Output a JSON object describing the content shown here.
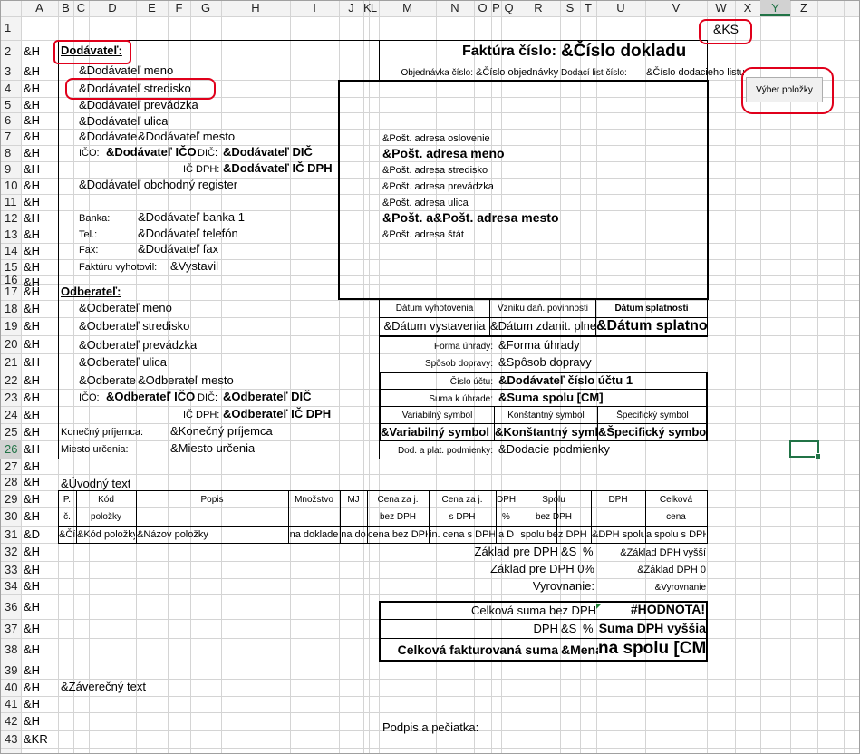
{
  "columns": [
    "A",
    "B",
    "C",
    "D",
    "E",
    "F",
    "G",
    "H",
    "I",
    "J",
    "K",
    "L",
    "M",
    "N",
    "O",
    "P",
    "Q",
    "R",
    "S",
    "T",
    "U",
    "V",
    "W",
    "X",
    "Y",
    "Z"
  ],
  "rows": [
    "1",
    "2",
    "3",
    "4",
    "5",
    "6",
    "7",
    "8",
    "9",
    "10",
    "11",
    "12",
    "13",
    "14",
    "15",
    "16",
    "17",
    "18",
    "19",
    "20",
    "21",
    "22",
    "23",
    "24",
    "25",
    "26",
    "27",
    "28",
    "29",
    "30",
    "31",
    "32",
    "33",
    "34",
    "36",
    "37",
    "38",
    "39",
    "40",
    "41",
    "42",
    "43"
  ],
  "colA": [
    "",
    "&H",
    "&H",
    "&H",
    "&H",
    "&H",
    "&H",
    "&H",
    "&H",
    "&H",
    "&H",
    "&H",
    "&H",
    "&H",
    "&H",
    "&H",
    "&H",
    "&H",
    "&H",
    "&H",
    "&H",
    "&H",
    "&H",
    "&H",
    "&H",
    "&H",
    "&H",
    "&H",
    "&H",
    "&H",
    "&D",
    "&H",
    "&H",
    "&H",
    "&H",
    "&H",
    "&H",
    "&H",
    "&H",
    "&H",
    "&H",
    "&KR"
  ],
  "macro_button": "Výber položky",
  "ks": "&KS",
  "supplier": {
    "heading": "Dodávateľ:",
    "name": "&Dodávateľ meno",
    "branch": "&Dodávateľ stredisko",
    "shop": "&Dodávateľ prevádzka",
    "street": "&Dodávateľ ulica",
    "zip": "&Dodávateľ",
    "city": "&Dodávateľ mesto",
    "ico_label": "IČO:",
    "ico": "&Dodávateľ IČO",
    "dic_label": "DIČ:",
    "dic": "&Dodávateľ DIČ",
    "icdph_label": "IČ DPH:",
    "icdph": "&Dodávateľ IČ DPH",
    "register": "&Dodávateľ obchodný register",
    "bank_label": "Banka:",
    "bank": "&Dodávateľ banka 1",
    "phone_label": "Tel.:",
    "phone": "&Dodávateľ telefón",
    "fax_label": "Fax:",
    "fax": "&Dodávateľ fax",
    "issuer_label": "Faktúru vyhotovil:",
    "issuer": "&Vystavil"
  },
  "invoice": {
    "title_label": "Faktúra číslo:",
    "number": "&Číslo dokladu",
    "order_label": "Objednávka číslo:",
    "order": "&Číslo objednávky",
    "delivery_label": "Dodací list číslo:",
    "delivery": "&Číslo dodacieho listu"
  },
  "post": {
    "salutation": "&Pošt. adresa oslovenie",
    "name": "&Pošt. adresa meno",
    "branch": "&Pošt. adresa stredisko",
    "shop": "&Pošt. adresa prevádzka",
    "street": "&Pošt. adresa ulica",
    "zip": "&Pošt. a",
    "city": "&Pošt. adresa mesto",
    "country": "&Pošt. adresa štát"
  },
  "customer": {
    "heading": "Odberateľ:",
    "name": "&Odberateľ meno",
    "branch": "&Odberateľ stredisko",
    "shop": "&Odberateľ prevádzka",
    "street": "&Odberateľ ulica",
    "zip": "&Odberate",
    "city": "&Odberateľ mesto",
    "ico_label": "IČO:",
    "ico": "&Odberateľ IČO",
    "dic_label": "DIČ:",
    "dic": "&Odberateľ DIČ",
    "icdph_label": "IČ DPH:",
    "icdph": "&Odberateľ IČ DPH",
    "final_label": "Konečný príjemca:",
    "final": "&Konečný príjemca",
    "dest_label": "Miesto určenia:",
    "dest": "&Miesto určenia"
  },
  "dates": {
    "issue_label": "Dátum vyhotovenia",
    "tax_label": "Vzniku daň. povinnosti",
    "due_label": "Dátum splatnosti",
    "issue": "&Dátum vystavenia",
    "tax": "&Dátum zdanit. plnenia",
    "due": "&Dátum splatnosti"
  },
  "payment": {
    "method_label": "Forma úhrady:",
    "method": "&Forma úhrady",
    "transport_label": "Spôsob dopravy:",
    "transport": "&Spôsob dopravy",
    "account_label": "Číslo účtu:",
    "account": "&Dodávateľ číslo účtu 1",
    "sum_label": "Suma k úhrade:",
    "sum": "&Suma spolu [CM]",
    "vs_label": "Variabilný symbol",
    "ks_label": "Konštantný symbol",
    "ss_label": "Špecifický symbol",
    "vs": "&Variabilný symbol",
    "ks": "&Konštantný symbol",
    "ss": "&Špecifický symbol",
    "terms_label": "Dod. a plat. podmienky:",
    "terms": "&Dodacie podmienky"
  },
  "intro": "&Úvodný text",
  "items": {
    "h1": [
      "P.",
      "Kód",
      "Popis",
      "Množstvo",
      "MJ",
      "Cena za j.",
      "Cena za j.",
      "DPH",
      "Spolu",
      "DPH",
      "Celková"
    ],
    "h2": [
      "č.",
      "položky",
      "",
      "",
      "",
      "bez DPH",
      "s DPH",
      "%",
      "bez DPH",
      "",
      "cena"
    ],
    "row": [
      "&Číslo",
      "&Kód položky",
      "&Názov položky",
      "na doklade",
      "na do",
      "cena bez DPH",
      "in. cena s DPH",
      "a D",
      "spolu bez DPH",
      "&DPH spolu",
      "a spolu s DPH"
    ]
  },
  "totals": {
    "base_label": "Základ pre DPH",
    "base_rate": "&S",
    "base_pct": "%",
    "base_val": "&Základ DPH vyšší",
    "base0_label": "Základ pre DPH 0%",
    "base0_val": "&Základ DPH 0",
    "round_label": "Vyrovnanie:",
    "round_val": "&Vyrovnanie",
    "total_nodph_label": "Celková suma bez DPH",
    "total_nodph_val": "#HODNOTA!",
    "dph_label": "DPH",
    "dph_rate": "&S",
    "dph_pct": "%",
    "dph_val": "Suma DPH vyššia",
    "grand_label": "Celková fakturovaná suma",
    "grand_cur": "&Mena",
    "grand_val": "na spolu [CM]"
  },
  "closing": "&Záverečný text",
  "signature": "Podpis a pečiatka:"
}
